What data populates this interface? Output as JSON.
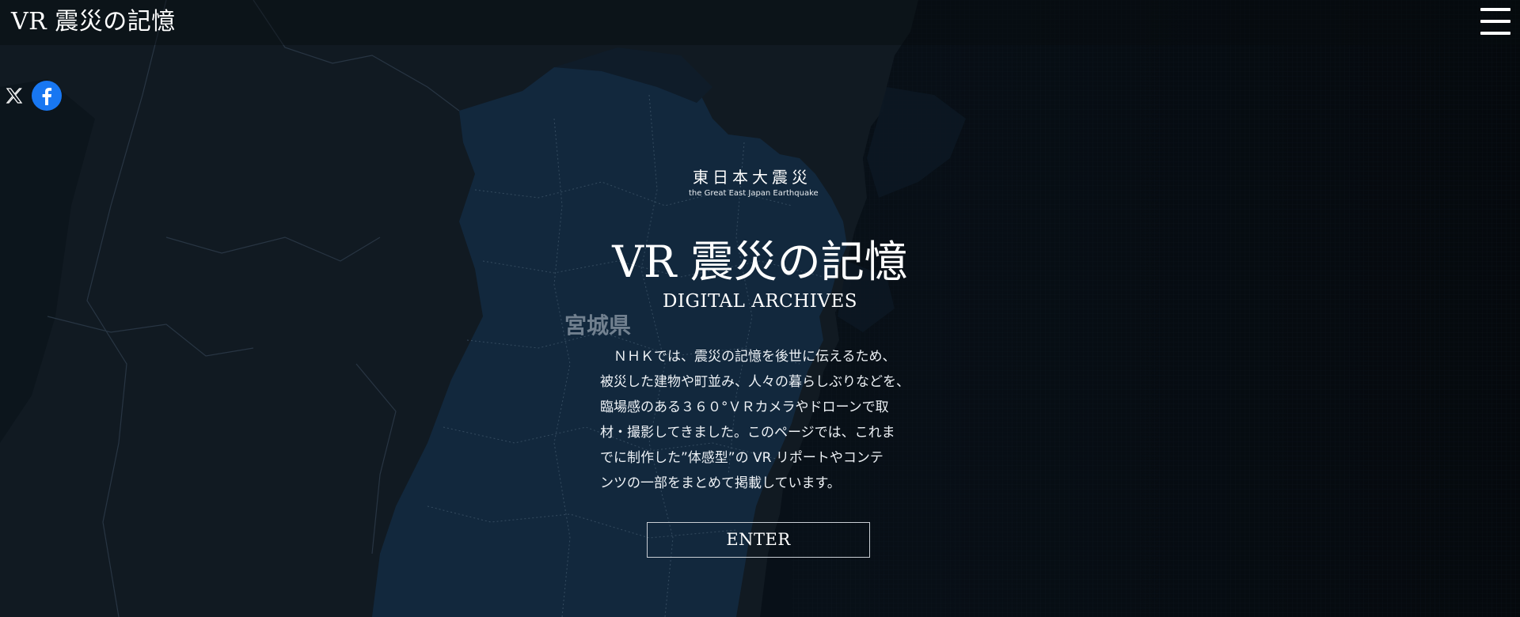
{
  "header": {
    "title": "VR 震災の記憶",
    "menu_icon": "hamburger-menu-icon"
  },
  "share": {
    "x_icon": "x-logo-icon",
    "facebook_icon": "facebook-logo-icon",
    "facebook_color": "#1877f2"
  },
  "map": {
    "prefecture_label": "宮城県",
    "colors": {
      "background": "#0b141f",
      "land": "#111a22",
      "highlight": "#12283d",
      "coast": "#0c1722"
    }
  },
  "hero": {
    "event_jp": "東日本大震災",
    "event_en": "the Great East Japan Earthquake",
    "title": "VR 震災の記憶",
    "subtitle": "DIGITAL ARCHIVES",
    "description_lines": [
      "　ＮＨＫでは、震災の記憶を後世に伝えるため、",
      "被災した建物や町並み、人々の暮らしぶりなどを、",
      "臨場感のある３６０°ＶＲカメラやドローンで取",
      "材・撮影してきました。このページでは、これま",
      "でに制作した”体感型”の VR リポートやコンテ",
      "ンツの一部をまとめて掲載しています。"
    ],
    "enter_label": "ENTER"
  }
}
